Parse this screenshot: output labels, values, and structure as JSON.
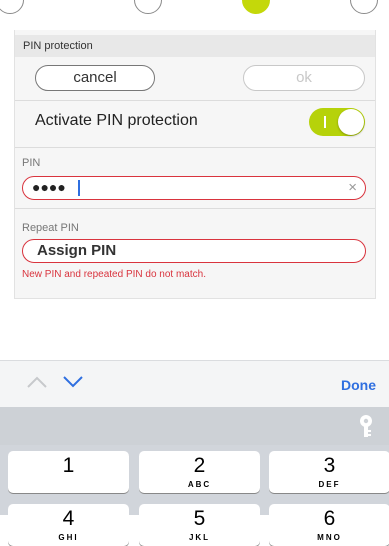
{
  "panel": {
    "section_title": "PIN protection",
    "cancel_label": "cancel",
    "ok_label": "ok",
    "activate_label": "Activate PIN protection",
    "activate_on": true
  },
  "pin": {
    "label": "PIN",
    "masked_value": "●●●●",
    "clear_glyph": "×"
  },
  "repeat_pin": {
    "label": "Repeat PIN",
    "placeholder": "Assign PIN",
    "error": "New PIN and repeated PIN do not match."
  },
  "accessory": {
    "done_label": "Done"
  },
  "keyboard": {
    "keys": [
      {
        "digit": "1",
        "letters": ""
      },
      {
        "digit": "2",
        "letters": "ABC"
      },
      {
        "digit": "3",
        "letters": "DEF"
      },
      {
        "digit": "4",
        "letters": "GHI"
      },
      {
        "digit": "5",
        "letters": "JKL"
      },
      {
        "digit": "6",
        "letters": "MNO"
      }
    ]
  },
  "colors": {
    "accent_green": "#b6d20a",
    "error_red": "#d9343e",
    "ios_blue": "#2f6fe0"
  }
}
